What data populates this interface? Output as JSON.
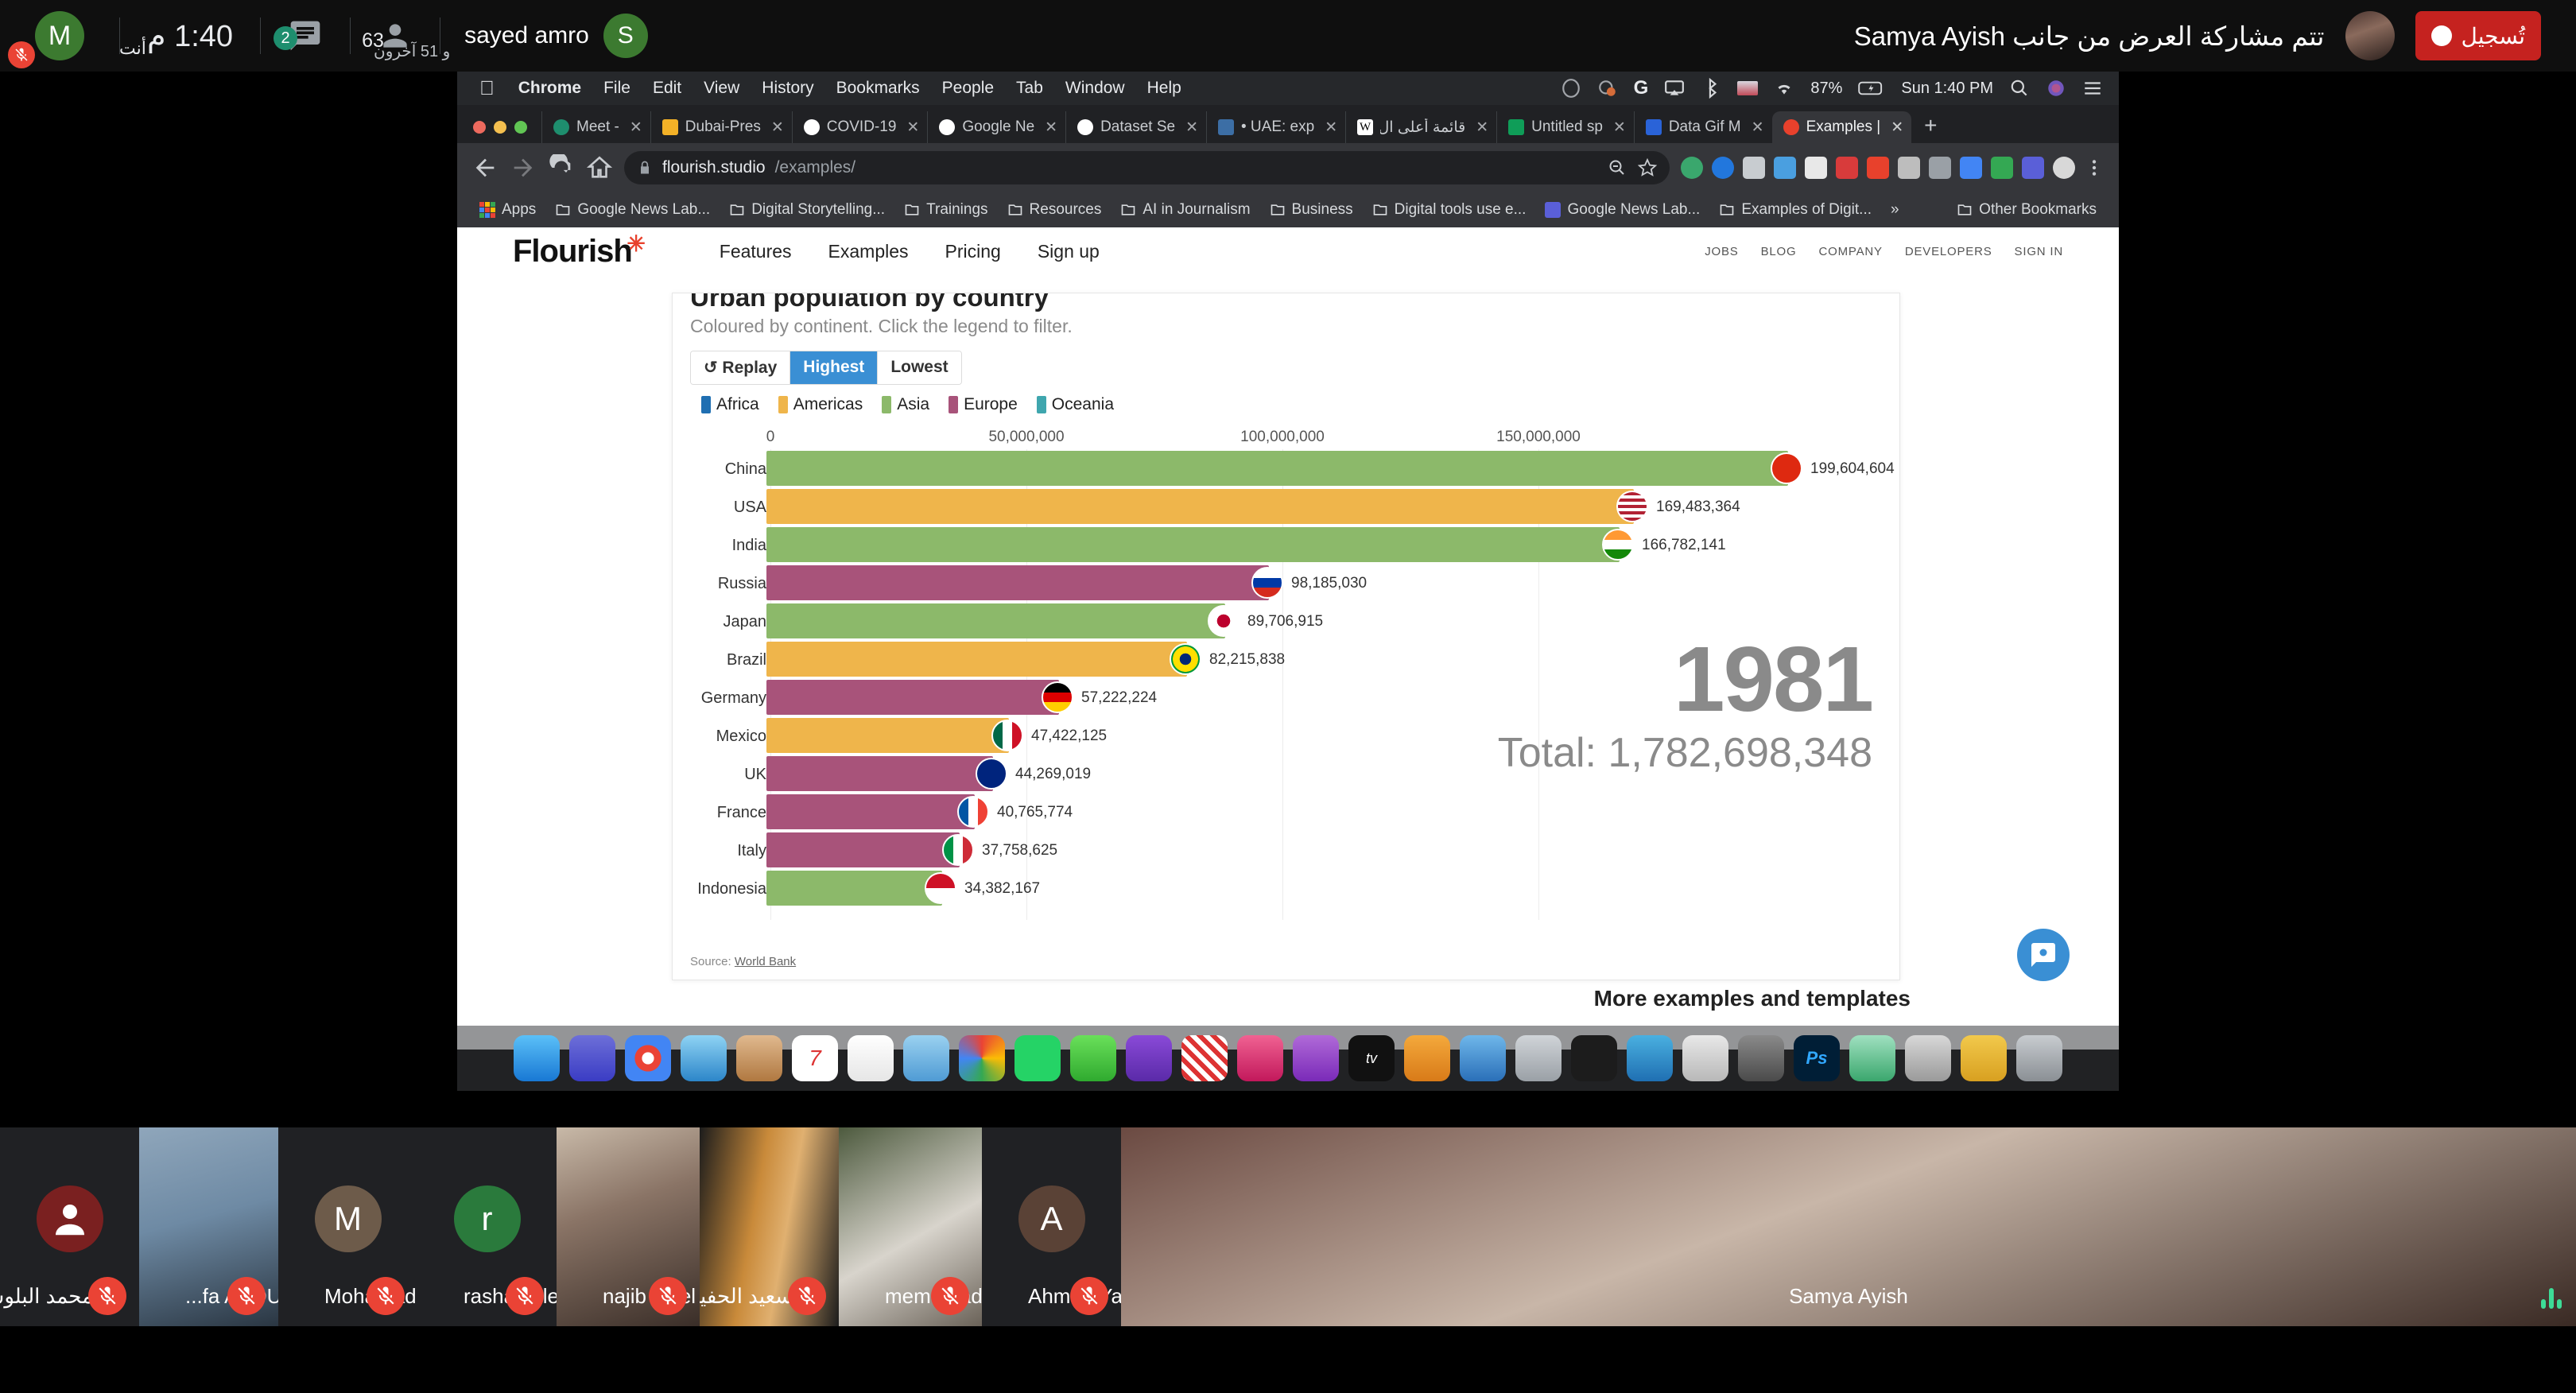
{
  "meet": {
    "self_label": "أنت",
    "self_initial": "M",
    "time": "1:40 م",
    "chat_count": "2",
    "people_count": "63",
    "active_speaker": "sayed amro",
    "active_speaker_initial": "S",
    "others_label": "و 51 آخرون",
    "share_notice": "تتم مشاركة العرض من جانب Samya Ayish",
    "record_label": "تُسجيل",
    "icons": {
      "chat": "chat-icon",
      "people": "people-icon",
      "mic_off": "mic-off-icon"
    }
  },
  "macos": {
    "apple": "",
    "menus": [
      "Chrome",
      "File",
      "Edit",
      "View",
      "History",
      "Bookmarks",
      "People",
      "Tab",
      "Window",
      "Help"
    ],
    "status": {
      "battery": "87%",
      "clock": "Sun 1:40 PM",
      "icons": [
        "skype-icon",
        "dropbox-icon",
        "google-icon",
        "airplay-icon",
        "bluetooth-icon",
        "flag-icon",
        "wifi-icon",
        "battery-icon",
        "search-icon",
        "siri-icon",
        "control-center-icon"
      ]
    }
  },
  "chrome": {
    "tabs": [
      {
        "label": "Meet -",
        "favicon": "meet-icon",
        "active": false
      },
      {
        "label": "Dubai-Pres",
        "favicon": "slides-icon",
        "active": false
      },
      {
        "label": "COVID-19",
        "favicon": "google-icon",
        "active": false
      },
      {
        "label": "Google Ne",
        "favicon": "google-icon",
        "active": false
      },
      {
        "label": "Dataset Se",
        "favicon": "google-icon",
        "active": false
      },
      {
        "label": "• UAE: exp",
        "favicon": "generic-icon",
        "active": false
      },
      {
        "label": "قائمة أعلى ال",
        "favicon": "wikipedia-icon",
        "active": false
      },
      {
        "label": "Untitled sp",
        "favicon": "sheets-icon",
        "active": false
      },
      {
        "label": "Data Gif M",
        "favicon": "datagif-icon",
        "active": false
      },
      {
        "label": "Examples |",
        "favicon": "flourish-icon",
        "active": true
      }
    ],
    "new_tab_label": "+",
    "close_label": "✕",
    "omnibox": {
      "url_domain": "flourish.studio",
      "url_path": "/examples/",
      "lock_icon": "lock-icon",
      "zoom_icon": "zoom-out-icon",
      "star_icon": "star-icon"
    },
    "nav_icons": [
      "back-arrow-icon",
      "forward-arrow-icon",
      "reload-icon",
      "home-icon"
    ],
    "bookmarks": [
      {
        "label": "Apps",
        "icon": "apps-grid-icon"
      },
      {
        "label": "Google News Lab...",
        "icon": "folder-icon"
      },
      {
        "label": "Digital Storytelling...",
        "icon": "folder-icon"
      },
      {
        "label": "Trainings",
        "icon": "folder-icon"
      },
      {
        "label": "Resources",
        "icon": "folder-icon"
      },
      {
        "label": "AI in Journalism",
        "icon": "folder-icon"
      },
      {
        "label": "Business",
        "icon": "folder-icon"
      },
      {
        "label": "Digital tools use e...",
        "icon": "folder-icon"
      },
      {
        "label": "Google News Lab...",
        "icon": "slides-icon"
      },
      {
        "label": "Examples of Digit...",
        "icon": "folder-icon"
      }
    ],
    "bookmarks_overflow": "»",
    "other_bookmarks": "Other Bookmarks"
  },
  "flourish": {
    "logo": "Flourish",
    "nav": [
      "Features",
      "Examples",
      "Pricing",
      "Sign up"
    ],
    "nav_right": [
      "JOBS",
      "BLOG",
      "COMPANY",
      "DEVELOPERS",
      "SIGN IN"
    ],
    "more_examples": "More examples and templates",
    "help_icon": "help-chat-icon"
  },
  "chart_data": {
    "type": "bar",
    "orientation": "horizontal",
    "title": "Urban population by country",
    "subtitle": "Coloured by continent. Click the legend to filter.",
    "controls": [
      {
        "label": "↺ Replay",
        "active": false
      },
      {
        "label": "Highest",
        "active": true
      },
      {
        "label": "Lowest",
        "active": false
      }
    ],
    "legend_position": "top",
    "legend": [
      {
        "name": "Africa",
        "color": "#1f6fb2"
      },
      {
        "name": "Americas",
        "color": "#efb54b"
      },
      {
        "name": "Asia",
        "color": "#8cb96a"
      },
      {
        "name": "Europe",
        "color": "#a8537a"
      },
      {
        "name": "Oceania",
        "color": "#3fa6ae"
      }
    ],
    "xlabel": "",
    "ylabel": "",
    "xlim": [
      0,
      210000000
    ],
    "xticks": [
      0,
      50000000,
      100000000,
      150000000
    ],
    "xtick_labels": [
      "0",
      "50,000,000",
      "100,000,000",
      "150,000,000"
    ],
    "grid": true,
    "year": "1981",
    "total_label": "Total: 1,782,698,348",
    "source": "Source: ",
    "source_link": "World Bank",
    "categories": [
      "China",
      "USA",
      "India",
      "Russia",
      "Japan",
      "Brazil",
      "Germany",
      "Mexico",
      "UK",
      "France",
      "Italy",
      "Indonesia"
    ],
    "values": [
      199604604,
      169483364,
      166782141,
      98185030,
      89706915,
      82215838,
      57222224,
      47422125,
      44269019,
      40765774,
      37758625,
      34382167
    ],
    "value_labels": [
      "199,604,604",
      "169,483,364",
      "166,782,141",
      "98,185,030",
      "89,706,915",
      "82,215,838",
      "57,222,224",
      "47,422,125",
      "44,269,019",
      "40,765,774",
      "37,758,625",
      "34,382,167"
    ],
    "continents": [
      "Asia",
      "Americas",
      "Asia",
      "Europe",
      "Asia",
      "Americas",
      "Europe",
      "Americas",
      "Europe",
      "Europe",
      "Europe",
      "Asia"
    ],
    "flags": [
      "china-flag",
      "usa-flag",
      "india-flag",
      "russia-flag",
      "japan-flag",
      "brazil-flag",
      "germany-flag",
      "mexico-flag",
      "uk-flag",
      "france-flag",
      "italy-flag",
      "indonesia-flag"
    ]
  },
  "participants": [
    {
      "name": "محمد البلوشي",
      "rtl": true,
      "muted": true,
      "kind": "avatar",
      "initial": "",
      "color": "#7a2020",
      "width": 175
    },
    {
      "name": "...fa ABDULAZIEM",
      "rtl": false,
      "muted": true,
      "kind": "video",
      "color": "#5f7e94",
      "width": 175
    },
    {
      "name": "Mohamad",
      "rtl": false,
      "muted": true,
      "kind": "avatar",
      "initial": "M",
      "color": "#6d5b4a",
      "width": 175
    },
    {
      "name": "rasha tbileh",
      "rtl": false,
      "muted": true,
      "kind": "avatar",
      "initial": "r",
      "color": "#2a7a3c",
      "width": 175
    },
    {
      "name": "najib ait el ghazi",
      "rtl": false,
      "muted": true,
      "kind": "video",
      "color": "#7c5a4a",
      "width": 180
    },
    {
      "name": "سعيد الحفيتي",
      "rtl": true,
      "muted": true,
      "kind": "video",
      "color": "#b07a3a",
      "width": 175
    },
    {
      "name": "meme badawy",
      "rtl": false,
      "muted": true,
      "kind": "video",
      "color": "#4d5a3e",
      "width": 180
    },
    {
      "name": "Ahmed Yahya",
      "rtl": false,
      "muted": true,
      "kind": "avatar",
      "initial": "A",
      "color": "#5a4236",
      "width": 175
    },
    {
      "name": "Samya Ayish",
      "rtl": false,
      "muted": false,
      "kind": "video",
      "color": "#6b4a42",
      "width": 180
    }
  ]
}
